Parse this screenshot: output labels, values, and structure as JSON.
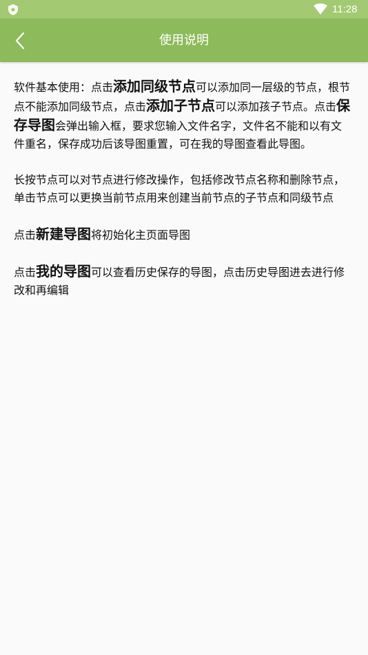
{
  "status_bar": {
    "time": "11:28",
    "left_icon": "shield-icon",
    "right_icon": "wifi-icon"
  },
  "app_bar": {
    "title": "使用说明",
    "back_icon": "chevron-left-icon",
    "color": "#8dba5a"
  },
  "content": {
    "p1": {
      "t1": "软件基本使用：点击",
      "b1": "添加同级节点",
      "t2": "可以添加同一层级的节点，根节点不能添加同级节点，点击",
      "b2": "添加子节点",
      "t3": "可以添加孩子节点。点击",
      "b3": "保存导图",
      "t4": "会弹出输入框，要求您输入文件名字，文件名不能和以有文件重名，保存成功后该导图重置，可在我的导图查看此导图。"
    },
    "p2": {
      "t1": "长按节点可以对节点进行修改操作，包括修改节点名称和删除节点，单击节点可以更换当前节点用来创建当前节点的子节点和同级节点"
    },
    "p3": {
      "t1": "点击",
      "b1": "新建导图",
      "t2": "将初始化主页面导图"
    },
    "p4": {
      "t1": "点击",
      "b1": "我的导图",
      "t2": "可以查看历史保存的导图，点击历史导图进去进行修改和再编辑"
    }
  }
}
